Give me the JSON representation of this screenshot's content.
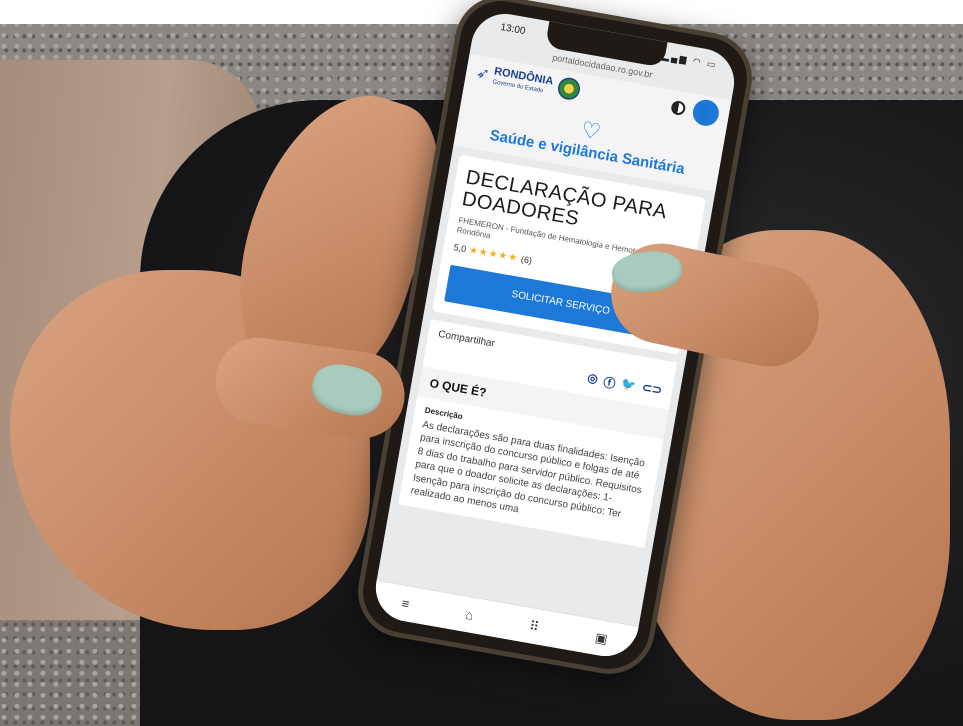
{
  "status_bar": {
    "time": "13:00",
    "icons": "▂▄▆ ◠ ▭"
  },
  "browser": {
    "url": "portaldocidadao.ro.gov.br"
  },
  "header": {
    "brand_name": "RONDÔNIA",
    "brand_sub": "Governo do Estado",
    "icons": {
      "logo": "bird-logo-icon",
      "theme": "contrast-icon",
      "user": "user-icon"
    }
  },
  "category": {
    "title": "Saúde e vigilância Sanitária",
    "icon": "heart-pulse-icon"
  },
  "service": {
    "title": "DECLARAÇÃO PARA DOADORES",
    "organization": "FHEMERON - Fundação de Hematologia e Hemoterapia de Rondônia",
    "rating_value": "5,0",
    "rating_stars": 5,
    "rating_count": "(6)",
    "cta_label": "SOLICITAR SERVIÇO"
  },
  "share": {
    "label": "Compartilhar",
    "icons": [
      "whatsapp-icon",
      "facebook-icon",
      "twitter-icon",
      "link-icon"
    ]
  },
  "section": {
    "heading": "O QUE É?",
    "label": "Descrição",
    "text": "As declarações são para duas finalidades: Isenção para inscrição do concurso público e folgas de até 8 dias do trabalho para servidor público. Requisitos para que o doador solicite as declarações: 1- Isenção para inscrição do concurso público: Ter realizado ao menos uma"
  },
  "bottom_nav": [
    "menu-icon",
    "home-icon",
    "apps-grid-icon",
    "profile-icon"
  ],
  "colors": {
    "primary": "#1e78d7",
    "brand": "#1b3f8b",
    "star": "#f2b01e",
    "nail": "#a9cbbd"
  }
}
